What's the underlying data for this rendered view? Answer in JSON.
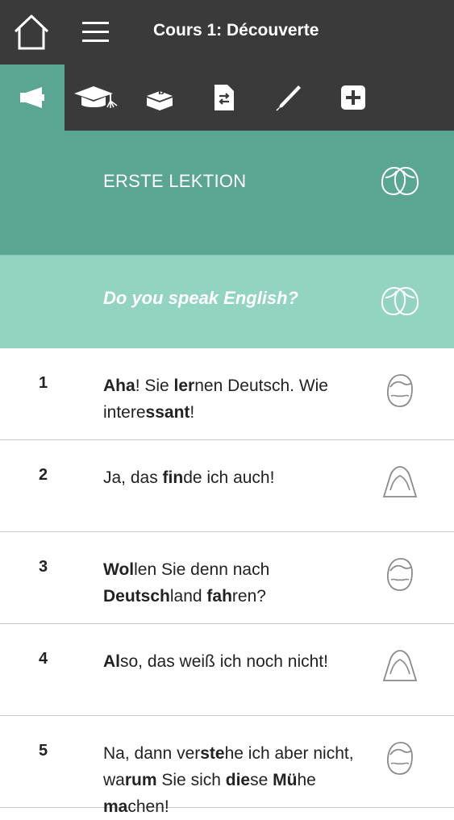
{
  "header": {
    "title": "Cours 1: Découverte"
  },
  "toolbar": {
    "tools": [
      {
        "icon": "megaphone-icon",
        "active": true
      },
      {
        "icon": "graduation-cap-icon",
        "active": false
      },
      {
        "icon": "exercise-box-icon",
        "active": false
      },
      {
        "icon": "document-swap-icon",
        "active": false
      },
      {
        "icon": "pen-icon",
        "active": false
      },
      {
        "icon": "plus-icon",
        "active": false
      }
    ]
  },
  "lesson": {
    "section_title": "ERSTE LEKTION",
    "subtitle": "Do you speak English?"
  },
  "dialogue": [
    {
      "number": "1",
      "speaker": "man-face-icon",
      "parts": [
        [
          "Aha",
          true
        ],
        [
          "! Sie ",
          false
        ],
        [
          "ler",
          true
        ],
        [
          "nen Deutsch. Wie intere",
          false
        ],
        [
          "ssant",
          true
        ],
        [
          "!",
          false
        ]
      ]
    },
    {
      "number": "2",
      "speaker": "woman-face-icon",
      "parts": [
        [
          "Ja, das ",
          false
        ],
        [
          "fin",
          true
        ],
        [
          "de ich auch!",
          false
        ]
      ]
    },
    {
      "number": "3",
      "speaker": "man-face-icon",
      "parts": [
        [
          "Wol",
          true
        ],
        [
          "len Sie denn nach ",
          false
        ],
        [
          "Deutsch",
          true
        ],
        [
          "land ",
          false
        ],
        [
          "fah",
          true
        ],
        [
          "ren?",
          false
        ]
      ]
    },
    {
      "number": "4",
      "speaker": "woman-face-icon",
      "parts": [
        [
          "Al",
          true
        ],
        [
          "so, das weiß ich noch nicht!",
          false
        ]
      ]
    },
    {
      "number": "5",
      "speaker": "man-face-icon",
      "parts": [
        [
          "Na, dann ver",
          false
        ],
        [
          "ste",
          true
        ],
        [
          "he ich aber nicht, wa",
          false
        ],
        [
          "rum",
          true
        ],
        [
          " Sie sich ",
          false
        ],
        [
          "die",
          true
        ],
        [
          "se ",
          false
        ],
        [
          "Mü",
          true
        ],
        [
          "he ",
          false
        ],
        [
          "ma",
          true
        ],
        [
          "chen!",
          false
        ]
      ]
    }
  ]
}
